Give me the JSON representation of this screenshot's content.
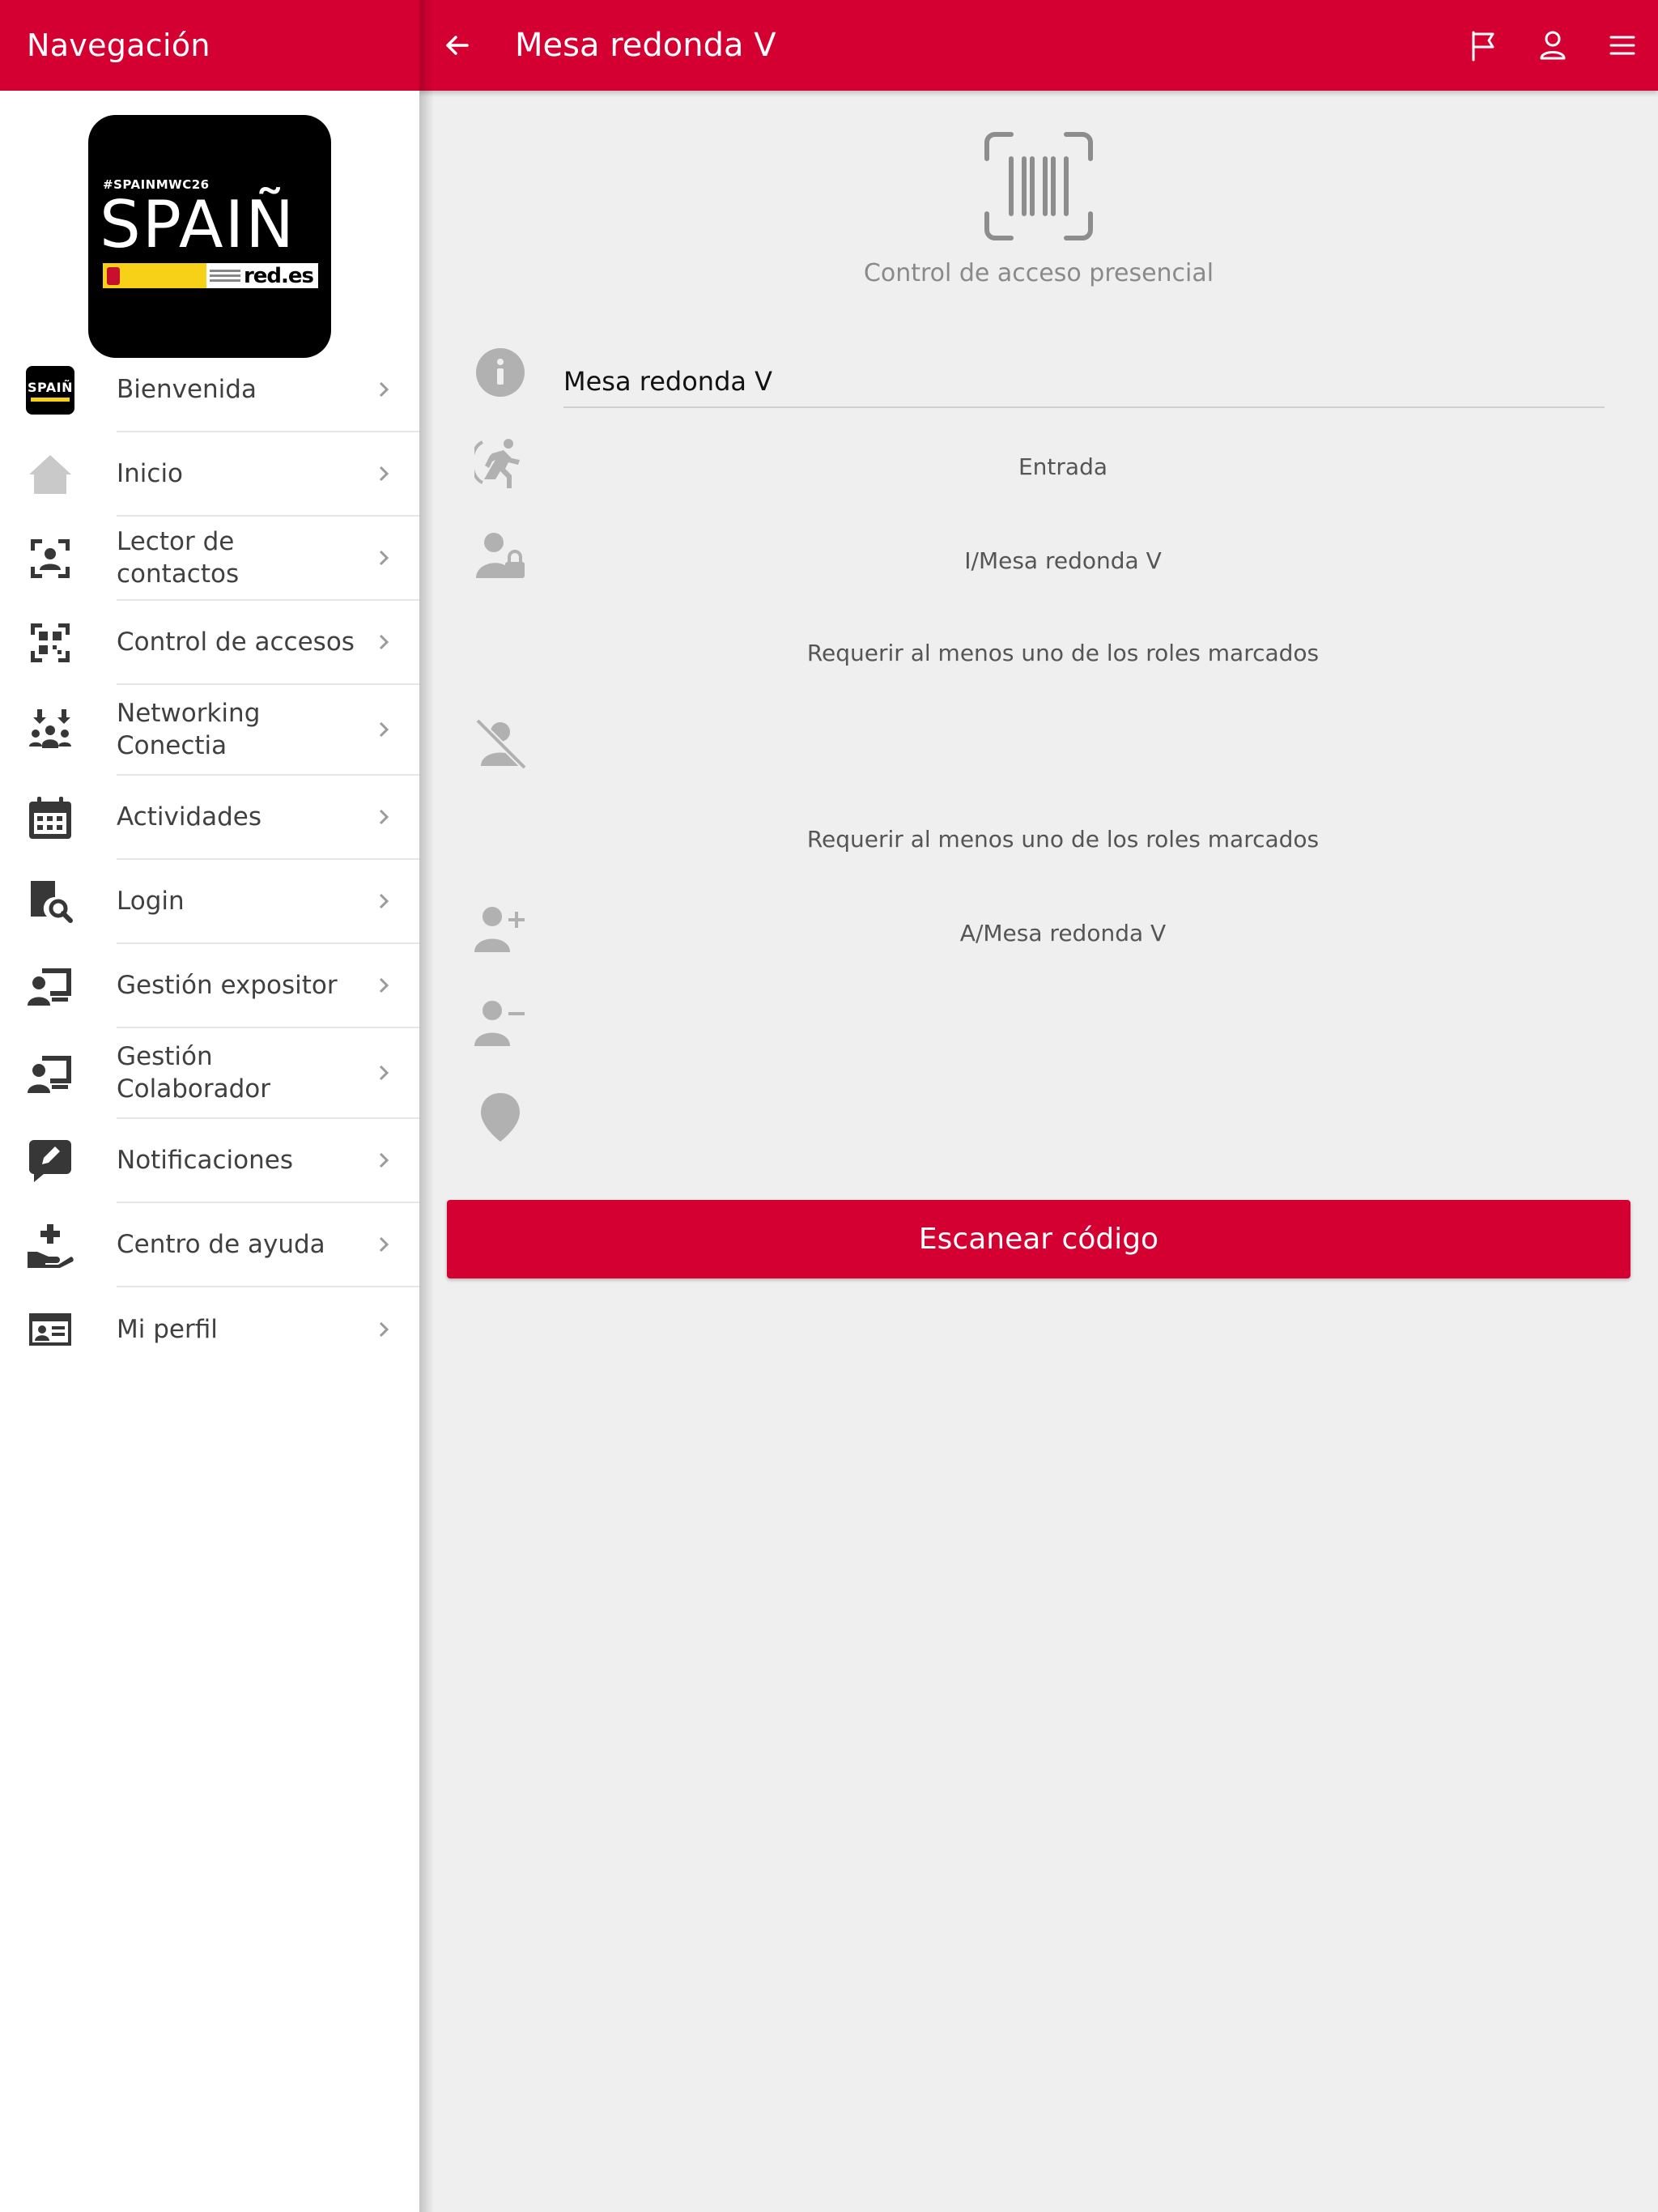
{
  "colors": {
    "brand": "#d50032",
    "icon_grey": "#b1b1b1",
    "background": "#efefef"
  },
  "sidebar": {
    "title": "Navegación",
    "logo": {
      "hashtag": "#SPAINMWC26",
      "wordmark": "SPAIÑ",
      "partner": "red.es"
    },
    "items": [
      {
        "label": "Bienvenida",
        "icon": "spain-logo-icon"
      },
      {
        "label": "Inicio",
        "icon": "home-icon"
      },
      {
        "label": "Lector de contactos",
        "icon": "contact-scan-icon"
      },
      {
        "label": "Control de accesos",
        "icon": "qr-code-icon"
      },
      {
        "label": "Networking Conectia",
        "icon": "networking-icon"
      },
      {
        "label": "Actividades",
        "icon": "calendar-icon"
      },
      {
        "label": "Login",
        "icon": "search-document-icon"
      },
      {
        "label": "Gestión expositor",
        "icon": "exhibitor-icon"
      },
      {
        "label": "Gestión Colaborador",
        "icon": "collaborator-icon"
      },
      {
        "label": "Notificaciones",
        "icon": "notification-edit-icon"
      },
      {
        "label": "Centro de ayuda",
        "icon": "help-hand-icon"
      },
      {
        "label": "Mi perfil",
        "icon": "id-card-icon"
      }
    ]
  },
  "header": {
    "title": "Mesa redonda V",
    "back_icon": "arrow-left-icon",
    "actions": [
      "flag-icon",
      "user-icon",
      "menu-icon"
    ]
  },
  "main": {
    "hero_icon": "barcode-scan-icon",
    "hero_subtitle": "Control de acceso presencial",
    "name_value": "Mesa redonda V",
    "direction": "Entrada",
    "access_role": "I/Mesa redonda V",
    "require_roles_1": "Requerir al menos uno de los roles marcados",
    "require_roles_2": "Requerir al menos uno de los roles marcados",
    "add_role": "A/Mesa redonda V",
    "scan_button": "Escanear código"
  }
}
